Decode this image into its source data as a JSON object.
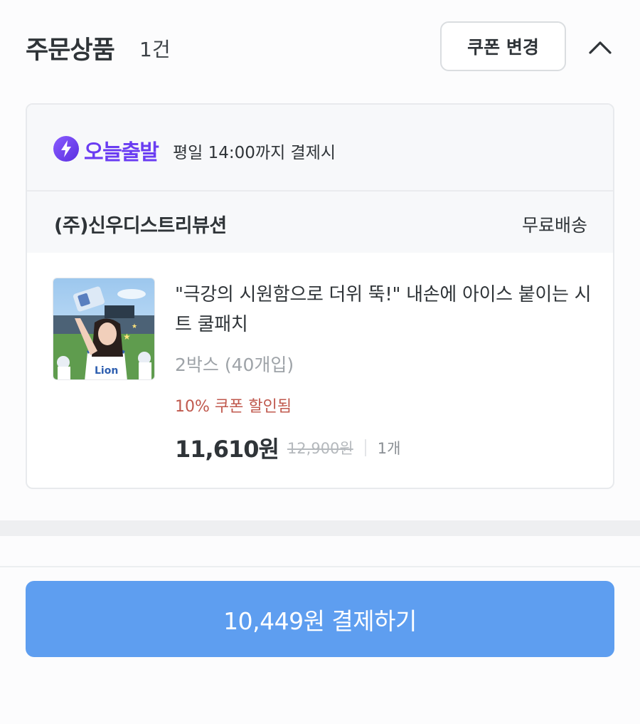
{
  "header": {
    "title": "주문상품",
    "count": "1건",
    "coupon_button": "쿠폰 변경",
    "collapse_icon": "chevron-up-icon"
  },
  "dispatch": {
    "badge_icon": "lightning-bolt-icon",
    "badge_text": "오늘출발",
    "note": "평일 14:00까지 결제시",
    "badge_color": "#6a3cf2"
  },
  "seller": {
    "name": "(주)신우디스트리뷰션",
    "shipping": "무료배송"
  },
  "product": {
    "name": "\"극강의 시원함으로 더위 뚝!\" 내손에 아이스 붙이는 시트 쿨패치",
    "option": "2박스 (40개입)",
    "coupon_text": "10% 쿠폰 할인됨",
    "price": "11,610원",
    "original_price": "12,900원",
    "quantity": "1개"
  },
  "footer": {
    "pay_button": "10,449원 결제하기",
    "pay_color": "#5e9ef0"
  }
}
